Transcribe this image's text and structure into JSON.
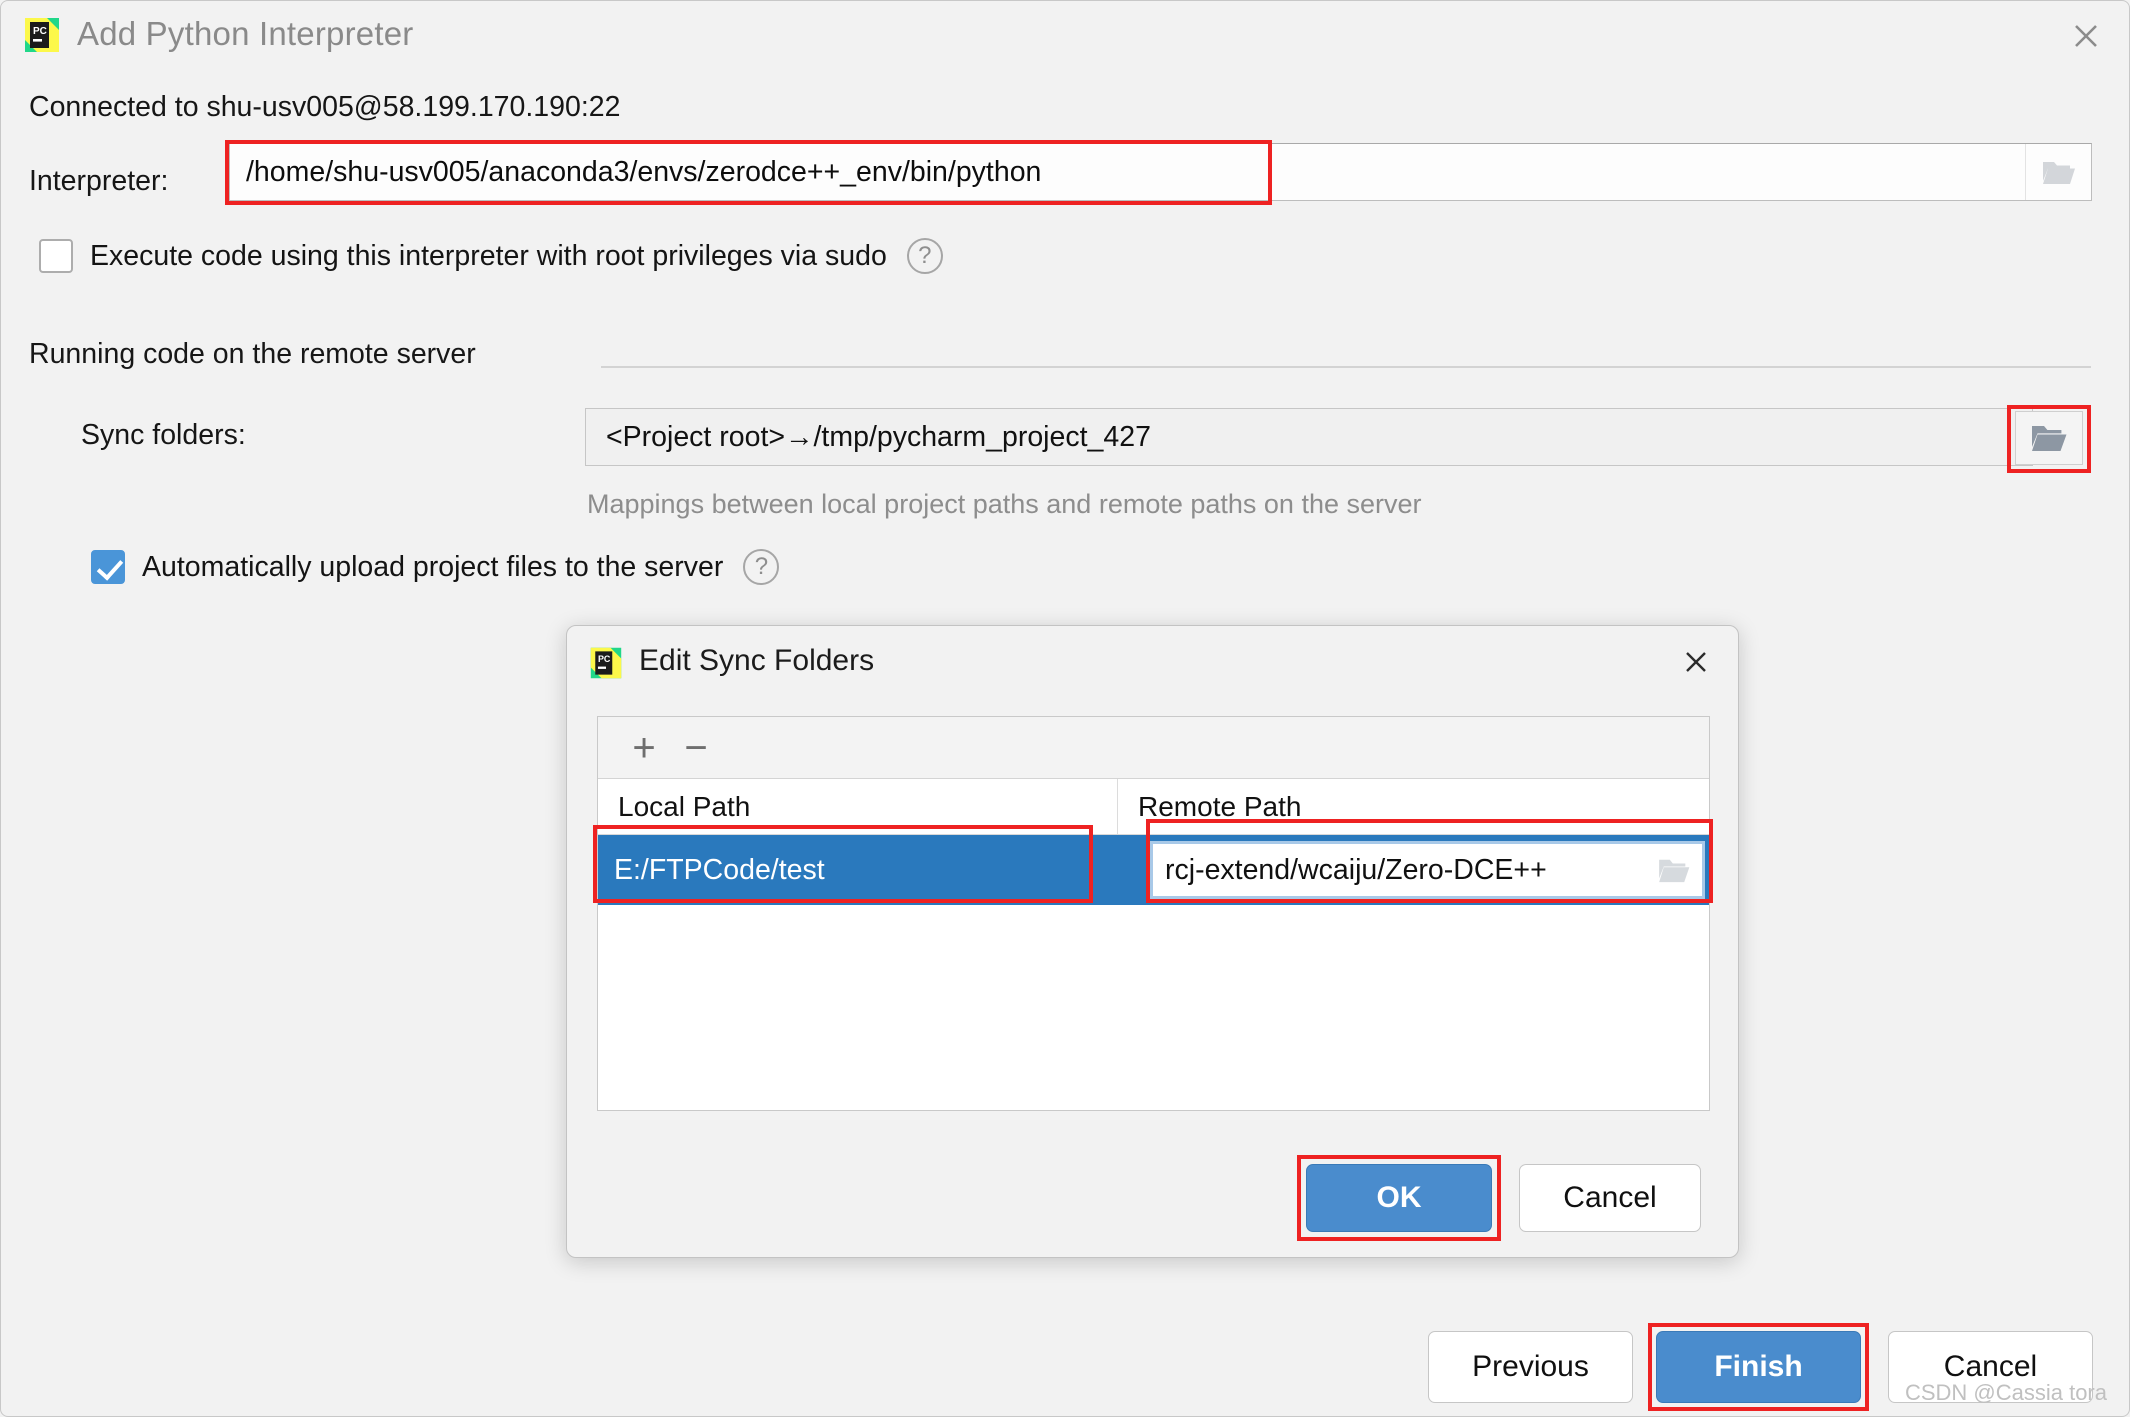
{
  "outer_dialog": {
    "title": "Add Python Interpreter",
    "logo_icon": "pycharm-logo-icon",
    "close_icon": "close-icon",
    "connected_status": "Connected to shu-usv005@58.199.170.190:22",
    "interpreter": {
      "label": "Interpreter:",
      "value": "/home/shu-usv005/anaconda3/envs/zerodce++_env/bin/python",
      "browse_icon": "folder-icon"
    },
    "sudo_checkbox": {
      "label": "Execute code using this interpreter with root privileges via sudo",
      "checked": false,
      "help_icon": "question-mark-icon",
      "help_glyph": "?"
    },
    "remote_section": {
      "title": "Running code on the remote server",
      "sync_folders": {
        "label": "Sync folders:",
        "value": "<Project root>→/tmp/pycharm_project_427",
        "browse_icon": "folder-icon"
      },
      "mappings_hint": "Mappings between local project paths and remote paths on the server",
      "auto_upload_checkbox": {
        "label": "Automatically upload project files to the server",
        "checked": true,
        "help_icon": "question-mark-icon",
        "help_glyph": "?"
      }
    },
    "footer": {
      "previous_label": "Previous",
      "finish_label": "Finish",
      "cancel_label": "Cancel"
    }
  },
  "inner_dialog": {
    "title": "Edit Sync Folders",
    "logo_icon": "pycharm-logo-icon",
    "close_icon": "close-icon",
    "toolbar": {
      "add_label": "+",
      "remove_label": "−"
    },
    "table": {
      "columns": [
        "Local Path",
        "Remote Path"
      ],
      "rows": [
        {
          "local_path": "E:/FTPCode/test",
          "remote_path": "rcj-extend/wcaiju/Zero-DCE++",
          "selected": true,
          "remote_browse_icon": "folder-icon"
        }
      ]
    },
    "footer": {
      "ok_label": "OK",
      "cancel_label": "Cancel"
    }
  },
  "watermark": "CSDN @Cassia tora",
  "colors": {
    "annotation_red": "#ee2222",
    "selection_blue": "#2a79bd",
    "default_button_blue": "#4a8ccd",
    "checkbox_blue": "#4a95d8",
    "background": "#f2f2f2"
  }
}
